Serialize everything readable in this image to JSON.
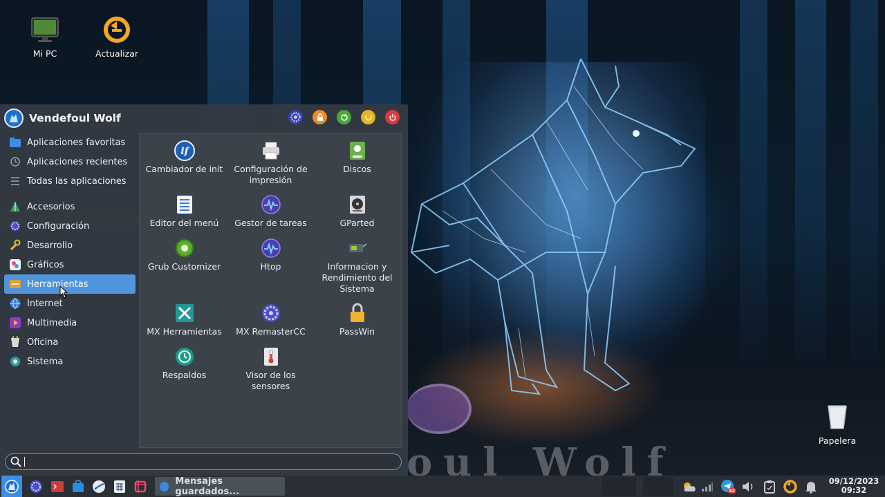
{
  "desktop": {
    "icons": [
      {
        "label": "Mi PC",
        "icon": "monitor-icon"
      },
      {
        "label": "Actualizar",
        "icon": "update-icon"
      },
      {
        "label": "Papelera",
        "icon": "trash-icon"
      }
    ],
    "watermark": "oul Wolf"
  },
  "menu": {
    "user": "Vendefoul Wolf",
    "header_buttons": [
      "settings-icon",
      "lock-icon",
      "switch-user-icon",
      "logout-icon",
      "power-icon"
    ],
    "categories": [
      {
        "label": "Aplicaciones favoritas",
        "icon": "favorites-icon"
      },
      {
        "label": "Aplicaciones recientes",
        "icon": "recent-icon"
      },
      {
        "label": "Todas las aplicaciones",
        "icon": "list-icon"
      },
      {
        "label": "Accesorios",
        "icon": "accessories-icon"
      },
      {
        "label": "Configuración",
        "icon": "settings-icon"
      },
      {
        "label": "Desarrollo",
        "icon": "development-icon"
      },
      {
        "label": "Gráficos",
        "icon": "graphics-icon"
      },
      {
        "label": "Herramientas",
        "icon": "tools-icon",
        "active": true
      },
      {
        "label": "Internet",
        "icon": "globe-icon"
      },
      {
        "label": "Multimedia",
        "icon": "multimedia-icon"
      },
      {
        "label": "Oficina",
        "icon": "office-icon"
      },
      {
        "label": "Sistema",
        "icon": "system-icon"
      }
    ],
    "apps": [
      {
        "label": "Cambiador de init",
        "icon": "init-switcher-icon"
      },
      {
        "label": "Configuración de impresión",
        "icon": "printer-icon"
      },
      {
        "label": "Discos",
        "icon": "disks-icon"
      },
      {
        "label": "Editor del menú",
        "icon": "menu-editor-icon"
      },
      {
        "label": "Gestor de tareas",
        "icon": "task-manager-icon"
      },
      {
        "label": "GParted",
        "icon": "gparted-icon"
      },
      {
        "label": "Grub Customizer",
        "icon": "grub-icon"
      },
      {
        "label": "Htop",
        "icon": "htop-icon"
      },
      {
        "label": "Informacion y Rendimiento del Sistema",
        "icon": "system-info-icon"
      },
      {
        "label": "MX Herramientas",
        "icon": "mx-tools-icon"
      },
      {
        "label": "MX RemasterCC",
        "icon": "remaster-icon"
      },
      {
        "label": "PassWin",
        "icon": "lock-icon"
      },
      {
        "label": "Respaldos",
        "icon": "backup-icon"
      },
      {
        "label": "Visor de los sensores",
        "icon": "thermometer-icon"
      }
    ],
    "search_value": ""
  },
  "taskbar": {
    "launchers": [
      "menu-icon",
      "settings-icon",
      "terminal-icon",
      "store-icon",
      "browser-icon",
      "calculator-icon",
      "screenshot-icon"
    ],
    "window_title": "Mensajes guardados...",
    "tray": [
      "weather-icon",
      "network-icon",
      "telegram-icon",
      "volume-icon",
      "clipboard-icon",
      "update-icon",
      "notifications-icon"
    ],
    "telegram_badge": "32",
    "clock": {
      "date": "09/12/2023",
      "time": "09:32"
    }
  },
  "colors": {
    "menu_bg": "#343a42",
    "active": "#4f95dd",
    "accent": "#1b6fd1"
  }
}
